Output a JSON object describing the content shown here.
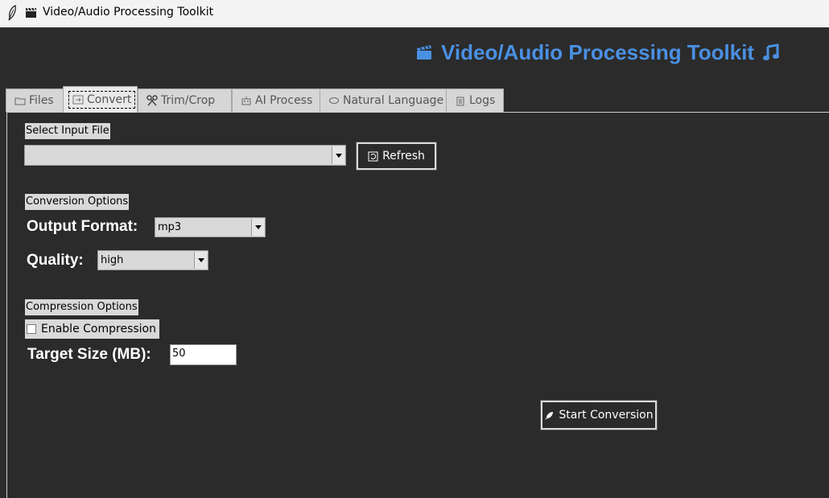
{
  "window": {
    "title": "Video/Audio Processing Toolkit"
  },
  "header": {
    "title": "Video/Audio Processing Toolkit",
    "color": "#4a90e2"
  },
  "tabs": [
    {
      "label": "Files",
      "icon": "folder-icon",
      "selected": false
    },
    {
      "label": "Convert",
      "icon": "convert-icon",
      "selected": true
    },
    {
      "label": "Trim/Crop",
      "icon": "scissors-icon",
      "selected": false
    },
    {
      "label": "AI Process",
      "icon": "robot-icon",
      "selected": false
    },
    {
      "label": "Natural Language",
      "icon": "speech-bubble-icon",
      "selected": false
    },
    {
      "label": "Logs",
      "icon": "clipboard-icon",
      "selected": false
    }
  ],
  "convert": {
    "input_section_label": "Select Input File",
    "input_file_value": "",
    "refresh_label": "Refresh",
    "conversion_section_label": "Conversion Options",
    "output_format_label": "Output Format:",
    "output_format_value": "mp3",
    "quality_label": "Quality:",
    "quality_value": "high",
    "compression_section_label": "Compression Options",
    "enable_compression_label": "Enable Compression",
    "enable_compression_checked": false,
    "target_size_label": "Target Size (MB):",
    "target_size_value": "50",
    "start_button_label": "Start Conversion"
  }
}
